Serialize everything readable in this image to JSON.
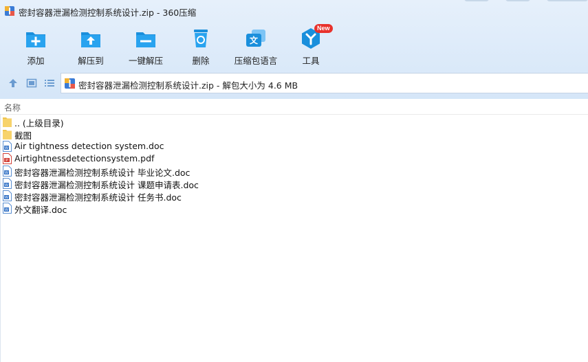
{
  "window": {
    "title": "密封容器泄漏检测控制系统设计.zip - 360压缩"
  },
  "toolbar": {
    "items": [
      {
        "label": "添加",
        "icon": "add-icon"
      },
      {
        "label": "解压到",
        "icon": "extract-to-icon"
      },
      {
        "label": "一键解压",
        "icon": "one-click-extract-icon"
      },
      {
        "label": "删除",
        "icon": "recycle-delete-icon"
      },
      {
        "label": "压缩包语言",
        "icon": "archive-language-icon"
      },
      {
        "label": "工具",
        "icon": "tools-icon",
        "badge": "New"
      }
    ]
  },
  "navbar": {
    "path_text": "密封容器泄漏检测控制系统设计.zip - 解包大小为 4.6 MB"
  },
  "list": {
    "column_name": "名称",
    "files": [
      {
        "name": ".. (上级目录)",
        "type": "folder"
      },
      {
        "name": "截图",
        "type": "folder"
      },
      {
        "name": "Air tightness detection system.doc",
        "type": "doc"
      },
      {
        "name": "Airtightnessdetectionsystem.pdf",
        "type": "pdf"
      },
      {
        "name": "密封容器泄漏检测控制系统设计 毕业论文.doc",
        "type": "doc"
      },
      {
        "name": "密封容器泄漏检测控制系统设计 课题申请表.doc",
        "type": "doc"
      },
      {
        "name": "密封容器泄漏检测控制系统设计 任务书.doc",
        "type": "doc"
      },
      {
        "name": "外文翻译.doc",
        "type": "doc"
      }
    ]
  },
  "colors": {
    "toolbar_bg": "#d9e8f8",
    "icon_blue": "#1a8fdc",
    "badge_red": "#e8322c",
    "folder_yellow": "#f7d36b"
  }
}
